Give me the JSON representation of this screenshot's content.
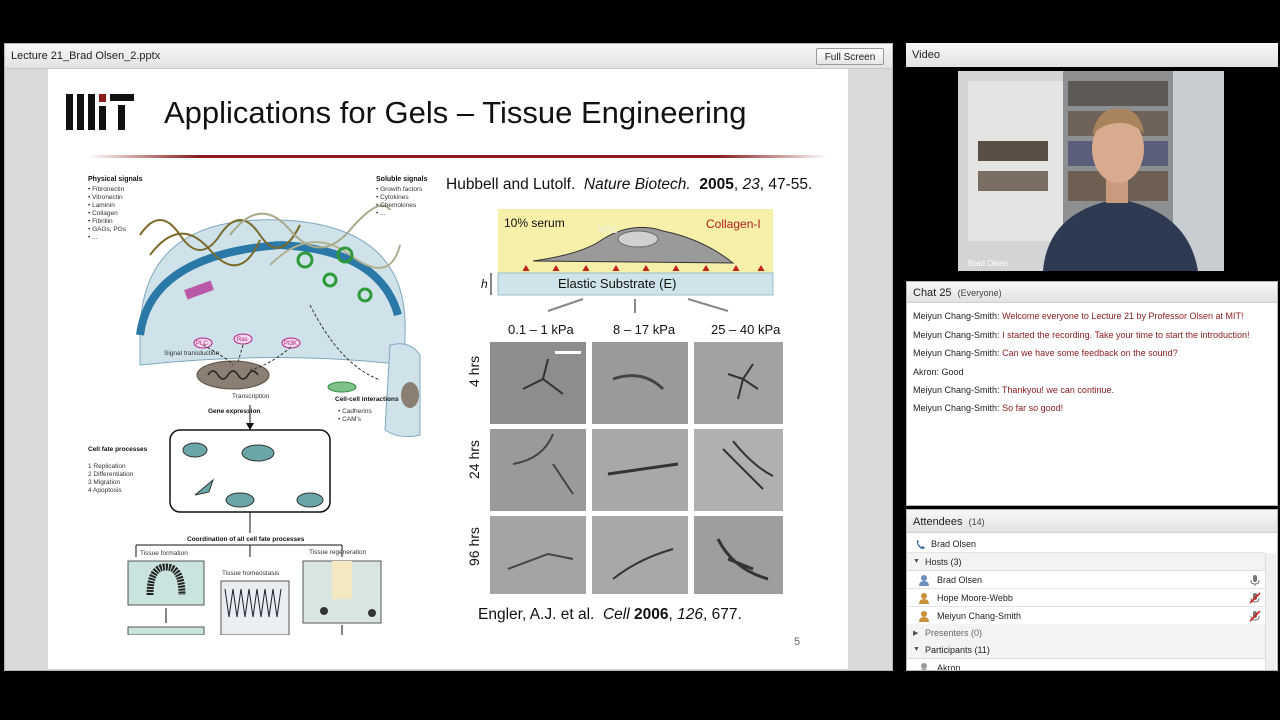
{
  "presentation": {
    "title": "Lecture 21_Brad Olsen_2.pptx",
    "fullscreen_label": "Full Screen",
    "slide": {
      "heading": "Applications for Gels – Tissue Engineering",
      "citation_top": {
        "authors": "Hubbell and Lutolf.",
        "journal": "Nature Biotech.",
        "year": "2005",
        "volume": "23",
        "pages": "47-55."
      },
      "citation_bottom": {
        "authors": "Engler, A.J. et al.",
        "journal": "Cell",
        "year": "2006",
        "volume": "126",
        "pages": "677."
      },
      "page_number": "5",
      "left_figure": {
        "physical_signals_title": "Physical signals",
        "physical_signals": [
          "• Fibronectin",
          "• Vitronectin",
          "• Laminin",
          "• Collagen",
          "• Fibrillin",
          "• GAGs, PGs",
          "• ..."
        ],
        "soluble_signals_title": "Soluble signals",
        "soluble_signals": [
          "• Growth factors",
          "• Cytokines",
          "• Chemokines",
          "• ..."
        ],
        "kinase_labels": [
          "PLC",
          "Ras",
          "PI3K"
        ],
        "signal_transduction": "Signal transduction",
        "transcription": "Transcription",
        "cell_cell_title": "Cell-cell interactions",
        "cell_cell_items": [
          "• Cadherins",
          "• CAM's"
        ],
        "gene_expression": "Gene expression",
        "cell_fate_title": "Cell fate processes",
        "cell_fate_items": [
          "1  Replication",
          "2  Differentiation",
          "3  Migration",
          "4  Apoptosis"
        ],
        "coordination": "Coordination of all cell fate processes",
        "tissue_formation": "Tissue formation",
        "tissue_homeostasis": "Tissue homeostasis",
        "tissue_regeneration": "Tissue regeneration"
      },
      "right_figure": {
        "serum": "10%  serum",
        "msc": "MSC",
        "collagen": "Collagen-I",
        "h_label": "h",
        "substrate": "Elastic Substrate (E)",
        "stiffness_labels": [
          "0.1 – 1 kPa",
          "8 – 17 kPa",
          "25 – 40 kPa"
        ],
        "time_labels": [
          "4 hrs",
          "24 hrs",
          "96 hrs"
        ]
      }
    }
  },
  "video": {
    "title": "Video",
    "caption": "Brad Olsen"
  },
  "chat": {
    "title": "Chat",
    "count": "25",
    "scope": "(Everyone)",
    "messages": [
      {
        "sender": "Meiyun Chang-Smith:",
        "text": "Welcome everyone to Lecture 21 by Professor Olsen at MIT!",
        "style": "red"
      },
      {
        "sender": "Meiyun Chang-Smith:",
        "text": "I started the recording. Take your time to start the introduction!",
        "style": "red"
      },
      {
        "sender": "Meiyun Chang-Smith:",
        "text": "Can we have some feedback on the sound?",
        "style": "red"
      },
      {
        "sender": "Akron:",
        "text": "Good",
        "style": "dark"
      },
      {
        "sender": "Meiyun Chang-Smith:",
        "text": "Thankyou! we can continue.",
        "style": "red"
      },
      {
        "sender": "Meiyun Chang-Smith:",
        "text": "So far so good!",
        "style": "red"
      }
    ]
  },
  "attendees": {
    "title": "Attendees",
    "count": "(14)",
    "presenter": "Brad Olsen",
    "hosts_label": "Hosts (3)",
    "hosts": [
      "Brad Olsen",
      "Hope Moore-Webb",
      "Meiyun Chang-Smith"
    ],
    "presenters_label": "Presenters (0)",
    "participants_label": "Participants (11)",
    "participants": [
      "Akron"
    ]
  },
  "colors": {
    "chat_message": "#8b1a1a",
    "rule": "#8b1a1a",
    "serum_band": "#f7f0a8",
    "substrate": "#cfe3ea"
  }
}
